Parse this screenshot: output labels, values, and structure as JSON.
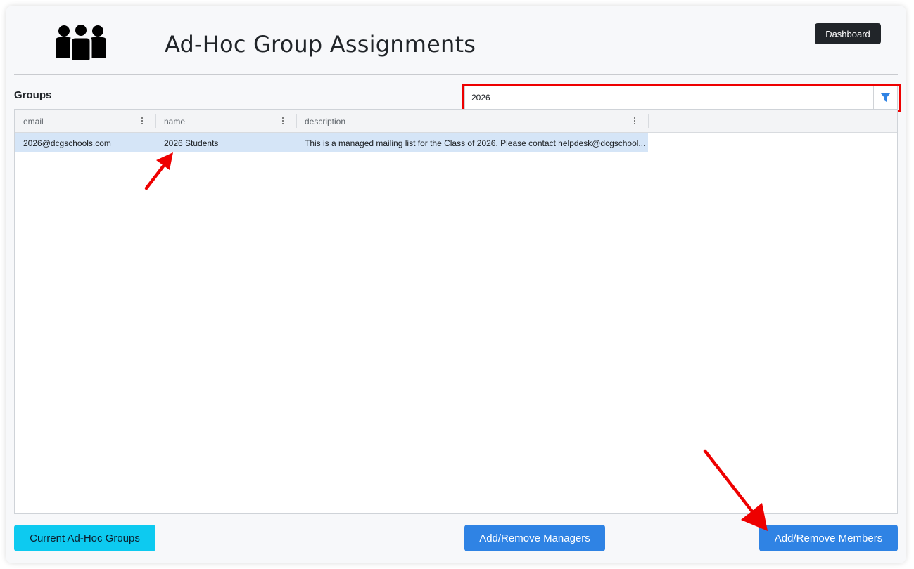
{
  "header": {
    "title": "Ad-Hoc Group Assignments",
    "dashboard_label": "Dashboard",
    "logo_icon": "people-group-icon"
  },
  "groups": {
    "label": "Groups",
    "filter_value": "2026",
    "filter_icon": "filter-icon",
    "columns": [
      "email",
      "name",
      "description"
    ],
    "rows": [
      {
        "email": "2026@dcgschools.com",
        "name": "2026 Students",
        "description": "This is a managed mailing list for the Class of 2026. Please contact helpdesk@dcgschool..."
      }
    ]
  },
  "footer": {
    "current_groups_label": "Current Ad-Hoc Groups",
    "managers_label": "Add/Remove Managers",
    "members_label": "Add/Remove Members"
  },
  "colors": {
    "annotation": "#ee0000",
    "primary": "#2f83e4",
    "info": "#0dcaf0",
    "selected_row": "#d5e5f7"
  }
}
